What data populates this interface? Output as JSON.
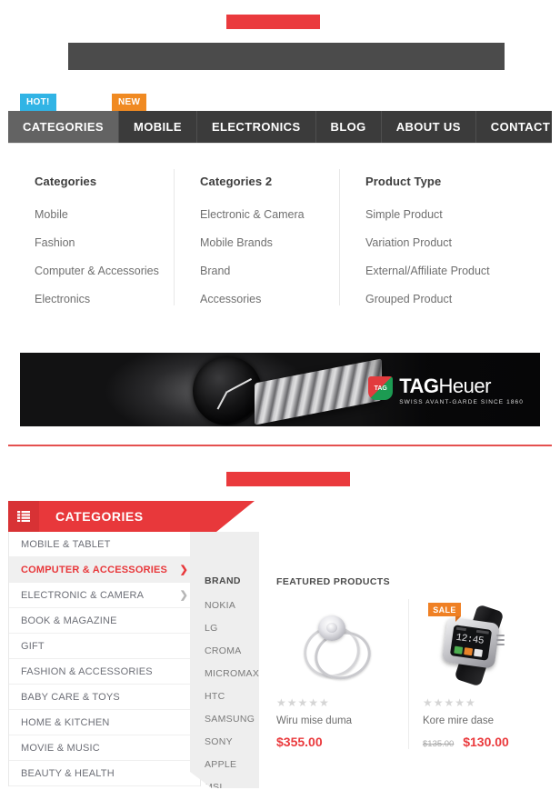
{
  "header": {
    "top_block_color": "#ea3a3d",
    "bar_color": "#4b4b4b"
  },
  "nav": {
    "items": [
      {
        "label": "CATEGORIES",
        "active": true
      },
      {
        "label": "MOBILE",
        "active": false
      },
      {
        "label": "ELECTRONICS",
        "active": false
      },
      {
        "label": "BLOG",
        "active": false
      },
      {
        "label": "ABOUT US",
        "active": false
      },
      {
        "label": "CONTACT US",
        "active": false
      }
    ],
    "badges": {
      "hot": "HOT!",
      "new": "NEW",
      "hot_color": "#31b4e5",
      "new_color": "#f08a22"
    }
  },
  "mega_menu": {
    "columns": [
      {
        "title": "Categories",
        "links": [
          "Mobile",
          "Fashion",
          "Computer & Accessories",
          "Electronics"
        ]
      },
      {
        "title": "Categories 2",
        "links": [
          "Electronic & Camera",
          "Mobile Brands",
          "Brand",
          "Accessories"
        ]
      },
      {
        "title": "Product Type",
        "links": [
          "Simple Product",
          "Variation Product",
          "External/Affiliate Product",
          "Grouped Product"
        ]
      }
    ]
  },
  "banner": {
    "brand_name_bold": "TAG",
    "brand_name_thin": "Heuer",
    "tagline": "SWISS AVANT-GARDE SINCE 1860",
    "shield_text": "TAG"
  },
  "categories_widget": {
    "title": "CATEGORIES",
    "accent_color": "#e8383b",
    "items": [
      {
        "label": "MOBILE & TABLET",
        "active": false,
        "has_arrow": false
      },
      {
        "label": "COMPUTER & ACCESSORIES",
        "active": true,
        "has_arrow": true
      },
      {
        "label": "ELECTRONIC & CAMERA",
        "active": false,
        "has_arrow": true
      },
      {
        "label": "BOOK & MAGAZINE",
        "active": false,
        "has_arrow": false
      },
      {
        "label": "GIFT",
        "active": false,
        "has_arrow": false
      },
      {
        "label": "FASHION & ACCESSORIES",
        "active": false,
        "has_arrow": false
      },
      {
        "label": "BABY CARE & TOYS",
        "active": false,
        "has_arrow": false
      },
      {
        "label": "HOME & KITCHEN",
        "active": false,
        "has_arrow": false
      },
      {
        "label": "MOVIE & MUSIC",
        "active": false,
        "has_arrow": false
      },
      {
        "label": "BEAUTY & HEALTH",
        "active": false,
        "has_arrow": false
      }
    ]
  },
  "brand_flyout": {
    "title": "BRAND",
    "brands": [
      "NOKIA",
      "LG",
      "CROMA",
      "MICROMAX",
      "HTC",
      "SAMSUNG",
      "SONY",
      "APPLE",
      "MSI"
    ]
  },
  "featured": {
    "title": "FEATURED PRODUCTS",
    "products": [
      {
        "name": "Wiru mise duma",
        "price": "$355.00",
        "old_price": "",
        "stars": "★★★★★",
        "badge": ""
      },
      {
        "name": "Kore mire dase",
        "price": "$130.00",
        "old_price": "$135.00",
        "stars": "★★★★★",
        "badge": "SALE"
      }
    ]
  },
  "smartwatch": {
    "time": "12:45"
  }
}
